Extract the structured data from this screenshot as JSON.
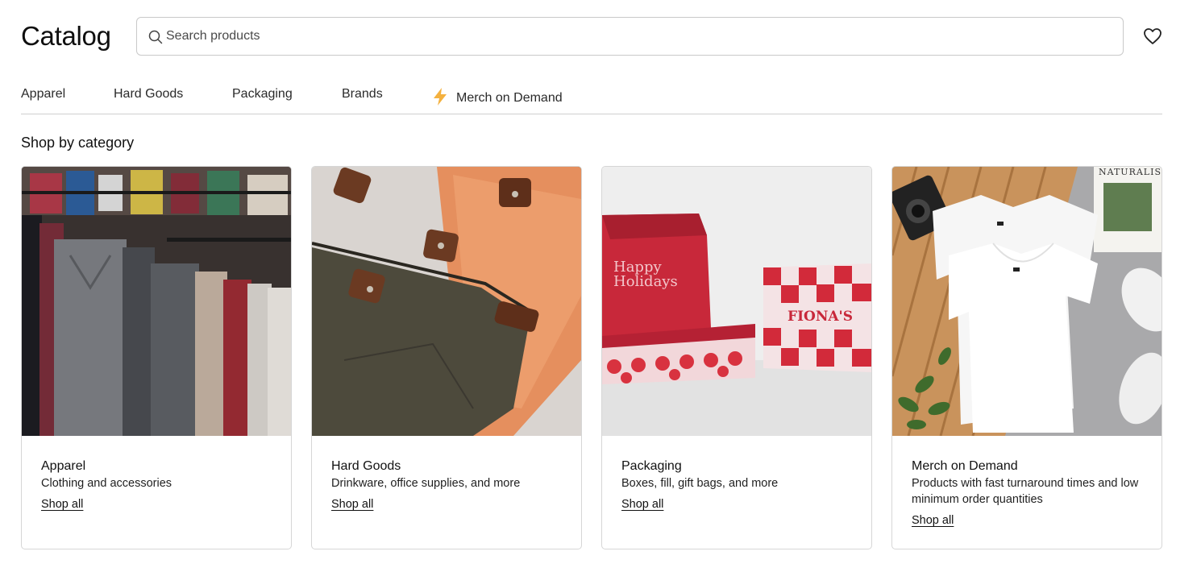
{
  "header": {
    "title": "Catalog",
    "search_placeholder": "Search products",
    "search_value": "",
    "search_icon": "search-icon",
    "favorites_icon": "heart-icon"
  },
  "nav": {
    "items": [
      {
        "label": "Apparel"
      },
      {
        "label": "Hard Goods"
      },
      {
        "label": "Packaging"
      },
      {
        "label": "Brands"
      },
      {
        "label": "Merch on Demand",
        "icon": "lightning-bolt-icon",
        "icon_color": "#f4b13f"
      }
    ]
  },
  "section": {
    "title": "Shop by category"
  },
  "cards": [
    {
      "title": "Apparel",
      "description": "Clothing and accessories",
      "link": "Shop all",
      "image": "clothing-rack-photo"
    },
    {
      "title": "Hard Goods",
      "description": "Drinkware, office supplies, and more",
      "link": "Shop all",
      "image": "pouches-photo"
    },
    {
      "title": "Packaging",
      "description": "Boxes, fill, gift bags, and more",
      "link": "Shop all",
      "image": "gift-boxes-photo",
      "box_text_1": "Happy",
      "box_text_2": "Holidays",
      "box_brand": "FIONA'S"
    },
    {
      "title": "Merch on Demand",
      "description": "Products with fast turnaround times and low minimum order quantities",
      "link": "Shop all",
      "image": "tshirt-flatlay-photo",
      "magazine_text": "NATURALIS"
    }
  ],
  "colors": {
    "border": "#d6d6d6",
    "accent_bolt": "#f4b13f",
    "text": "#111111"
  }
}
